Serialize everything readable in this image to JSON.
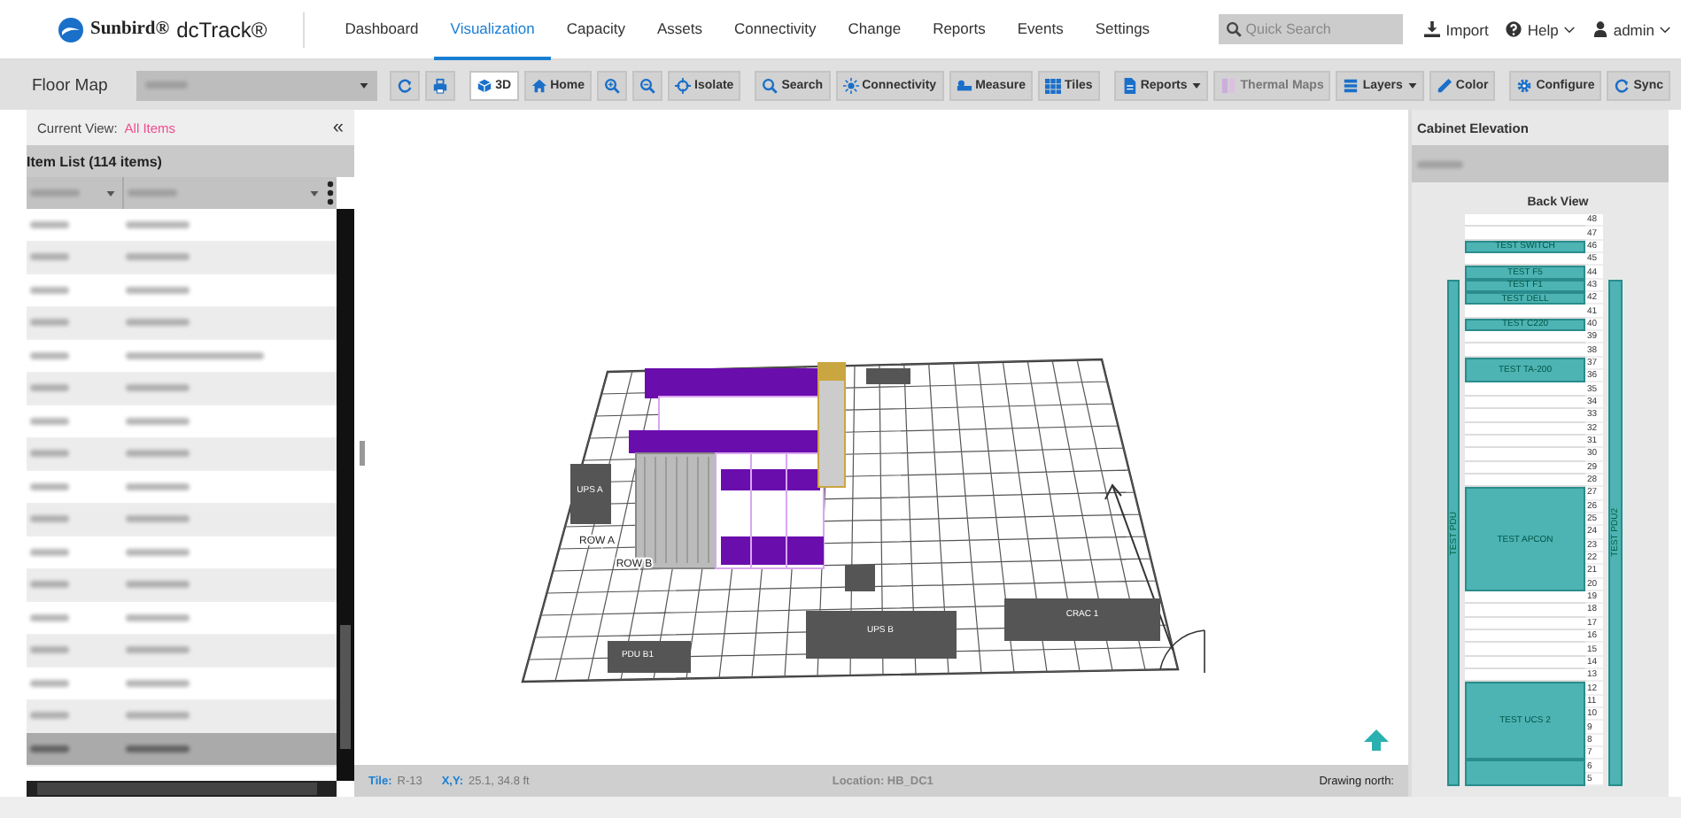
{
  "app": {
    "brand": "Sunbird®",
    "product": "dcTrack®"
  },
  "nav": [
    {
      "label": "Dashboard",
      "selected": false
    },
    {
      "label": "Visualization",
      "selected": true
    },
    {
      "label": "Capacity",
      "selected": false
    },
    {
      "label": "Assets",
      "selected": false
    },
    {
      "label": "Connectivity",
      "selected": false
    },
    {
      "label": "Change",
      "selected": false
    },
    {
      "label": "Reports",
      "selected": false
    },
    {
      "label": "Events",
      "selected": false
    },
    {
      "label": "Settings",
      "selected": false
    }
  ],
  "quick_search": {
    "placeholder": "Quick Search"
  },
  "user_menu": [
    {
      "kind": "import",
      "label": "Import",
      "dropdown": false
    },
    {
      "kind": "help",
      "label": "Help",
      "dropdown": true
    },
    {
      "kind": "user",
      "label": "admin",
      "dropdown": true
    }
  ],
  "toolbar": {
    "title": "Floor Map",
    "items": [
      {
        "kind": "refresh",
        "selected": false,
        "disabled": false,
        "dropdown": false
      },
      {
        "kind": "print",
        "selected": false,
        "disabled": false,
        "dropdown": false
      },
      {
        "kind": "cube",
        "label": "3D",
        "selected": true,
        "disabled": false,
        "dropdown": false
      },
      {
        "kind": "home",
        "label": "Home",
        "selected": false,
        "disabled": false,
        "dropdown": false
      },
      {
        "kind": "zoom-in",
        "selected": false,
        "disabled": false,
        "dropdown": false
      },
      {
        "kind": "zoom-out",
        "selected": false,
        "disabled": false,
        "dropdown": false
      },
      {
        "kind": "target",
        "label": "Isolate",
        "selected": false,
        "disabled": false,
        "dropdown": false
      },
      {
        "kind": "search",
        "label": "Search",
        "selected": false,
        "disabled": false,
        "dropdown": false
      },
      {
        "kind": "sun",
        "label": "Connectivity",
        "selected": false,
        "disabled": false,
        "dropdown": false
      },
      {
        "kind": "ruler",
        "label": "Measure",
        "selected": false,
        "disabled": false,
        "dropdown": false
      },
      {
        "kind": "grid",
        "label": "Tiles",
        "selected": false,
        "disabled": false,
        "dropdown": false
      },
      {
        "kind": "document",
        "label": "Reports",
        "selected": false,
        "disabled": false,
        "dropdown": true
      },
      {
        "kind": "thermal",
        "label": "Thermal Maps",
        "selected": false,
        "disabled": true,
        "dropdown": false
      },
      {
        "kind": "layers",
        "label": "Layers",
        "selected": false,
        "disabled": false,
        "dropdown": true
      },
      {
        "kind": "pencil",
        "label": "Color",
        "selected": false,
        "disabled": false,
        "dropdown": false
      },
      {
        "kind": "gear",
        "label": "Configure",
        "selected": false,
        "disabled": false,
        "dropdown": false
      },
      {
        "kind": "sync",
        "label": "Sync",
        "selected": false,
        "disabled": false,
        "dropdown": false
      }
    ]
  },
  "left_panel": {
    "current_view_label": "Current View:",
    "current_view": "All Items",
    "collapse": "«",
    "item_list_title": "Item List (114 items)",
    "rows": [
      {
        "selected": false
      },
      {
        "selected": false
      },
      {
        "selected": false
      },
      {
        "selected": false
      },
      {
        "selected": false
      },
      {
        "selected": false
      },
      {
        "selected": false
      },
      {
        "selected": false
      },
      {
        "selected": false
      },
      {
        "selected": false
      },
      {
        "selected": false
      },
      {
        "selected": false
      },
      {
        "selected": false
      },
      {
        "selected": false
      },
      {
        "selected": false
      },
      {
        "selected": false
      },
      {
        "selected": true
      }
    ]
  },
  "floor_map": {
    "labels": [
      "UPS A",
      "ROW A",
      "ROW B",
      "PDU B1",
      "UPS B",
      "CRAC 1"
    ],
    "status": [
      {
        "kind": "label",
        "text": "Tile:"
      },
      {
        "kind": "value",
        "text": "R-13"
      },
      {
        "kind": "label",
        "text": "X,Y:"
      },
      {
        "kind": "value",
        "text": "25.1, 34.8 ft"
      },
      {
        "kind": "center",
        "text": "Location: HB_DC1"
      },
      {
        "kind": "right",
        "text": "Drawing north:"
      }
    ]
  },
  "cabinet": {
    "title": "Cabinet Elevation",
    "view": "Back View",
    "pdus": [
      {
        "label": "TEST PDU"
      },
      {
        "label": "TEST PDU2"
      }
    ],
    "slots": [
      {
        "kind": "empty",
        "units": [
          "48"
        ]
      },
      {
        "kind": "empty",
        "units": [
          "47"
        ]
      },
      {
        "kind": "device",
        "label": "TEST SWITCH",
        "units": [
          "46"
        ]
      },
      {
        "kind": "empty",
        "units": [
          "45"
        ]
      },
      {
        "kind": "device",
        "label": "TEST F5",
        "units": [
          "44"
        ]
      },
      {
        "kind": "device",
        "label": "TEST F1",
        "units": [
          "43"
        ]
      },
      {
        "kind": "device",
        "label": "TEST DELL",
        "units": [
          "42"
        ]
      },
      {
        "kind": "empty",
        "units": [
          "41"
        ]
      },
      {
        "kind": "device",
        "label": "TEST C220",
        "units": [
          "40"
        ]
      },
      {
        "kind": "empty",
        "units": [
          "39"
        ]
      },
      {
        "kind": "empty",
        "units": [
          "38"
        ]
      },
      {
        "kind": "device",
        "label": "TEST TA-200",
        "units": [
          "37",
          "36"
        ]
      },
      {
        "kind": "empty",
        "units": [
          "35"
        ]
      },
      {
        "kind": "empty",
        "units": [
          "34"
        ]
      },
      {
        "kind": "empty",
        "units": [
          "33"
        ]
      },
      {
        "kind": "empty",
        "units": [
          "32"
        ]
      },
      {
        "kind": "empty",
        "units": [
          "31"
        ]
      },
      {
        "kind": "empty",
        "units": [
          "30"
        ]
      },
      {
        "kind": "empty",
        "units": [
          "29"
        ]
      },
      {
        "kind": "empty",
        "units": [
          "28"
        ]
      },
      {
        "kind": "device",
        "label": "TEST APCON",
        "units": [
          "27",
          "26",
          "25",
          "24",
          "23",
          "22",
          "21",
          "20"
        ]
      },
      {
        "kind": "empty",
        "units": [
          "19"
        ]
      },
      {
        "kind": "empty",
        "units": [
          "18"
        ]
      },
      {
        "kind": "empty",
        "units": [
          "17"
        ]
      },
      {
        "kind": "empty",
        "units": [
          "16"
        ]
      },
      {
        "kind": "empty",
        "units": [
          "15"
        ]
      },
      {
        "kind": "empty",
        "units": [
          "14"
        ]
      },
      {
        "kind": "empty",
        "units": [
          "13"
        ]
      },
      {
        "kind": "device",
        "label": "TEST UCS 2",
        "units": [
          "12",
          "11",
          "10",
          "9",
          "8",
          "7"
        ]
      },
      {
        "kind": "device",
        "units": [
          "6",
          "5"
        ]
      }
    ]
  }
}
